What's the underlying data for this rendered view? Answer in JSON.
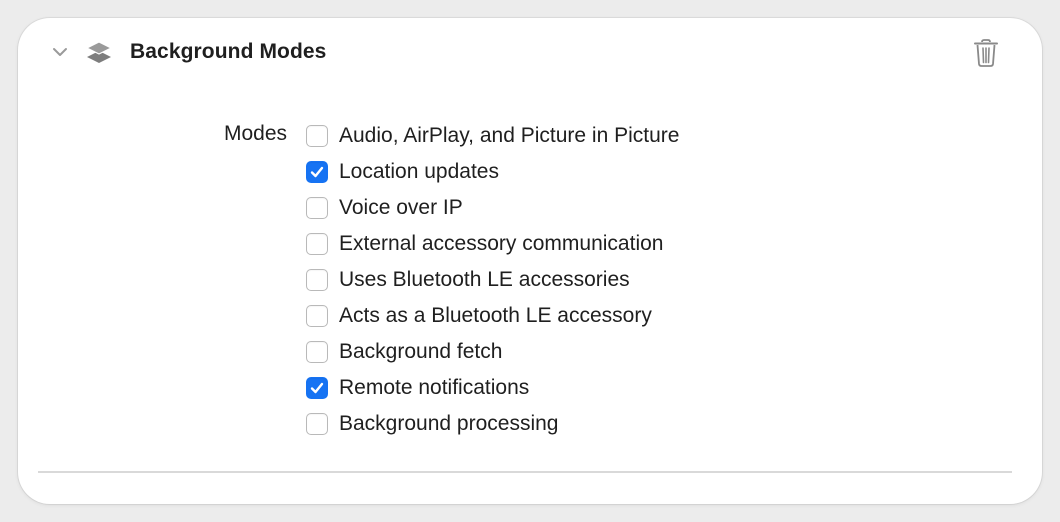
{
  "capability": {
    "title": "Background Modes",
    "disclosure_icon": "chevron-down-icon",
    "capability_icon": "layers-icon",
    "delete_icon": "trash-icon"
  },
  "modes": {
    "label": "Modes",
    "options": [
      {
        "label": "Audio, AirPlay, and Picture in Picture",
        "checked": false
      },
      {
        "label": "Location updates",
        "checked": true
      },
      {
        "label": "Voice over IP",
        "checked": false
      },
      {
        "label": "External accessory communication",
        "checked": false
      },
      {
        "label": "Uses Bluetooth LE accessories",
        "checked": false
      },
      {
        "label": "Acts as a Bluetooth LE accessory",
        "checked": false
      },
      {
        "label": "Background fetch",
        "checked": false
      },
      {
        "label": "Remote notifications",
        "checked": true
      },
      {
        "label": "Background processing",
        "checked": false
      }
    ]
  },
  "colors": {
    "accent": "#1673f3",
    "text": "#1f1f1f",
    "icon": "#8a8a8a"
  }
}
